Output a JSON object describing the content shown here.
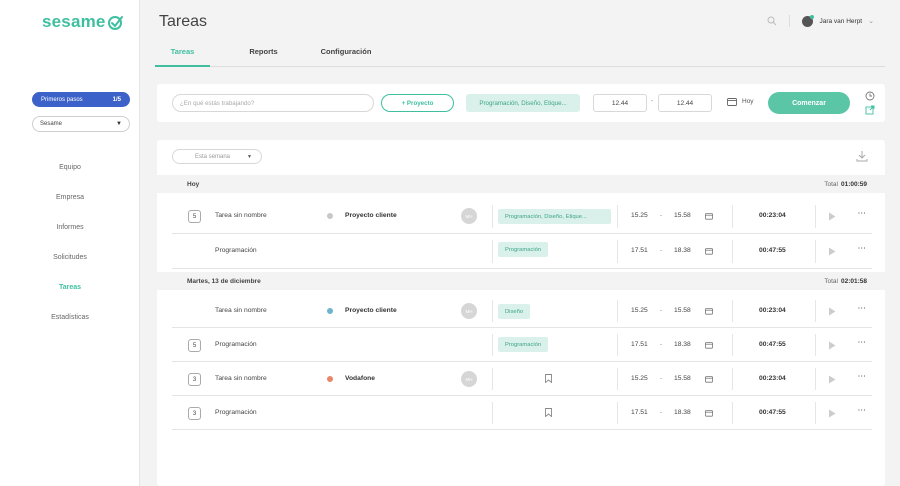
{
  "brand": {
    "logo_text": "sesame",
    "accent": "#3fbfa0"
  },
  "sidebar": {
    "first_steps": {
      "label": "Primeros pasos",
      "count": "1/5"
    },
    "company_select": {
      "value": "Sesame"
    },
    "items": [
      {
        "label": "Equipo"
      },
      {
        "label": "Empresa"
      },
      {
        "label": "Informes"
      },
      {
        "label": "Solicitudes"
      },
      {
        "label": "Tareas",
        "active": true
      },
      {
        "label": "Estadísticas"
      }
    ]
  },
  "header": {
    "title": "Tareas",
    "user_name": "Jara van Herpt",
    "tabs": [
      {
        "label": "Tareas",
        "active": true
      },
      {
        "label": "Reports"
      },
      {
        "label": "Configuración"
      }
    ]
  },
  "entry": {
    "task_placeholder": "¿En qué estás trabajando?",
    "project_button": "+ Proyecto",
    "tags": "Programación, Diseño, Etique...",
    "start_time": "12.44",
    "end_time": "12.44",
    "date_label": "Hoy",
    "start_button": "Comenzar"
  },
  "list": {
    "period_select": "Esta semana",
    "groups": [
      {
        "title": "Hoy",
        "total_label": "Total",
        "total": "01:00:59",
        "rows": [
          {
            "count": "5",
            "task": "Tarea sin nombre",
            "project": "Proyecto cliente",
            "project_color": "#c8c8c8",
            "avatar": "MH",
            "tag": "Programación, Diseño, Etique...",
            "start": "15.25",
            "end": "15.58",
            "duration": "00:23:04"
          },
          {
            "count": "",
            "task": "Programación",
            "project": "",
            "avatar": "",
            "tag": "Programación",
            "start": "17.51",
            "end": "18.38",
            "duration": "00:47:55"
          }
        ]
      },
      {
        "title": "Martes, 13 de diciembre",
        "total_label": "Total",
        "total": "02:01:58",
        "rows": [
          {
            "count": "",
            "task": "Tarea sin nombre",
            "project": "Proyecto cliente",
            "project_color": "#6fb3cc",
            "avatar": "MH",
            "tag": "Diseño",
            "start": "15.25",
            "end": "15.58",
            "duration": "00:23:04"
          },
          {
            "count": "5",
            "task": "Programación",
            "project": "",
            "avatar": "",
            "tag": "Programación",
            "start": "17.51",
            "end": "18.38",
            "duration": "00:47:55"
          },
          {
            "count": "3",
            "task": "Tarea sin nombre",
            "project": "Vodafone",
            "project_color": "#e8866a",
            "avatar": "MH",
            "tag": "",
            "start": "15.25",
            "end": "15.58",
            "duration": "00:23:04"
          },
          {
            "count": "3",
            "task": "Programación",
            "project": "",
            "avatar": "",
            "tag": "",
            "start": "17.51",
            "end": "18.38",
            "duration": "00:47:55"
          }
        ]
      }
    ]
  },
  "icons": {
    "search": "search-icon",
    "calendar": "calendar-icon",
    "clock": "clock-icon",
    "external": "external-link-icon",
    "download": "download-icon",
    "play": "play-icon",
    "more": "more-icon",
    "bookmark": "bookmark-icon"
  }
}
